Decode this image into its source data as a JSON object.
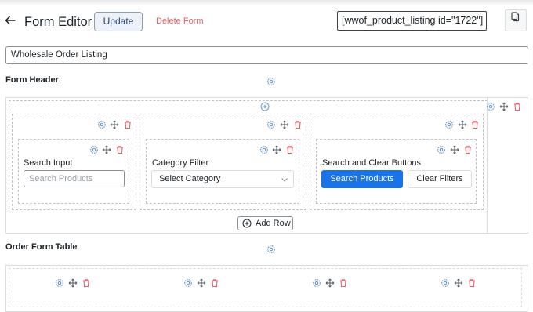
{
  "header": {
    "title": "Form Editor",
    "update_label": "Update",
    "delete_label": "Delete Form",
    "shortcode": "[wwof_product_listing id=\"1722\"]"
  },
  "form_name": "Wholesale Order Listing",
  "sections": {
    "form_header": "Form Header",
    "order_form_table": "Order Form Table"
  },
  "widgets": {
    "search_input": {
      "label": "Search Input",
      "placeholder": "Search Products"
    },
    "category_filter": {
      "label": "Category Filter",
      "selected": "Select Category"
    },
    "buttons": {
      "label": "Search and Clear Buttons",
      "search": "Search Products",
      "clear": "Clear Filters"
    }
  },
  "add_row_label": "Add Row",
  "colors": {
    "accent": "#1a73e8",
    "delete": "#e2606b",
    "settings_icon": "#6b9ac4"
  }
}
